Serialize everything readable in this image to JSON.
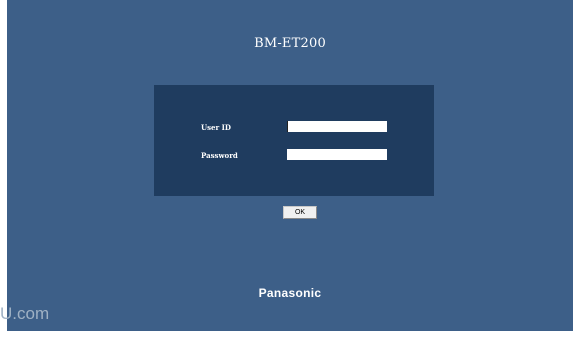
{
  "app": {
    "title": "BM-ET200"
  },
  "login": {
    "user_id_label": "User ID",
    "user_id_value": "",
    "password_label": "Password",
    "password_value": "",
    "ok_label": "OK"
  },
  "brand": {
    "logo_text": "Panasonic"
  },
  "watermark": {
    "text": "U.com"
  },
  "colors": {
    "background": "#3d5f88",
    "panel": "#1f3c5f",
    "text": "#ffffff"
  }
}
